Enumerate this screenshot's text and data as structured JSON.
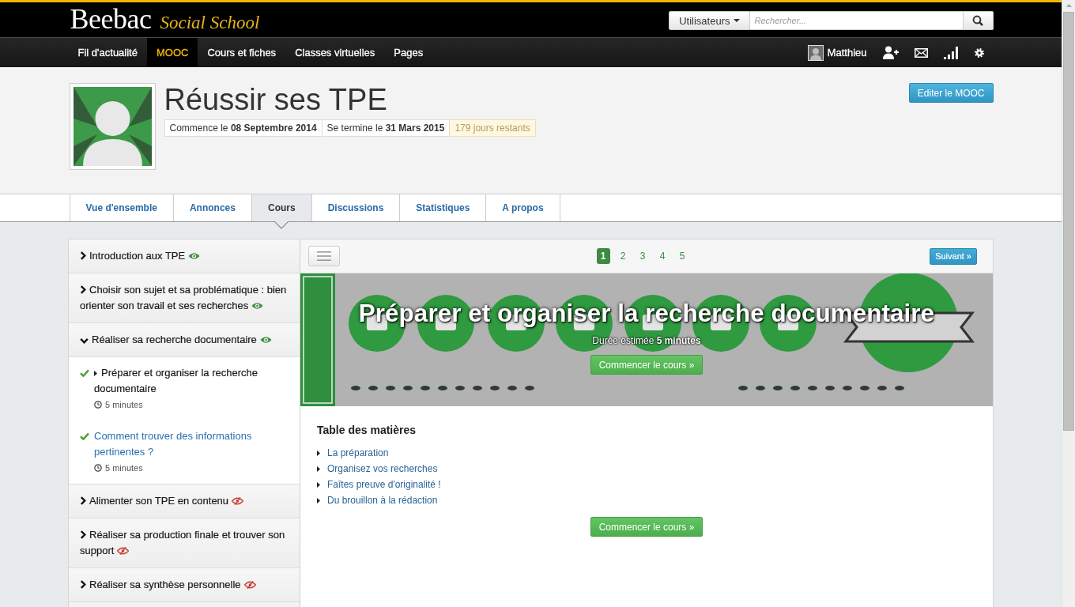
{
  "header": {
    "logo": "Beebac",
    "tagline": "Social School",
    "search": {
      "scope": "Utilisateurs",
      "placeholder": "Rechercher..."
    }
  },
  "nav": {
    "items": [
      {
        "label": "Fil d'actualité",
        "selected": false
      },
      {
        "label": "MOOC",
        "selected": true
      },
      {
        "label": "Cours et fiches",
        "selected": false
      },
      {
        "label": "Classes virtuelles",
        "selected": false
      },
      {
        "label": "Pages",
        "selected": false
      }
    ],
    "user": "Matthieu"
  },
  "course": {
    "title": "Réussir ses TPE",
    "dates": [
      {
        "kind": "date",
        "text": "Commence le **08 Septembre 2014**"
      },
      {
        "kind": "date",
        "text": "Se termine le **31 Mars 2015**"
      },
      {
        "kind": "remaining",
        "text": "179 jours restants"
      }
    ],
    "edit_button": "Editer le MOOC"
  },
  "tabs": [
    {
      "label": "Vue d'ensemble",
      "selected": false
    },
    {
      "label": "Annonces",
      "selected": false
    },
    {
      "label": "Cours",
      "selected": true
    },
    {
      "label": "Discussions",
      "selected": false
    },
    {
      "label": "Statistiques",
      "selected": false
    },
    {
      "label": "A propos",
      "selected": false
    }
  ],
  "sidebar": {
    "sections": [
      {
        "title": "Introduction aux TPE",
        "visible": true,
        "expanded": false
      },
      {
        "title": "Choisir son sujet et sa problématique : bien orienter son travail et ses recherches",
        "visible": true,
        "expanded": false
      },
      {
        "title": "Réaliser sa recherche documentaire",
        "visible": true,
        "expanded": true,
        "children": [
          {
            "title": "Préparer et organiser la recherche documentaire",
            "completed": true,
            "selected": true,
            "duration": "5 minutes"
          },
          {
            "title": "Comment trouver des informations pertinentes ?",
            "completed": true,
            "selected": false,
            "duration": "5 minutes"
          }
        ]
      },
      {
        "title": "Alimenter son TPE en contenu",
        "visible": false,
        "expanded": false
      },
      {
        "title": "Réaliser sa production finale et trouver son support",
        "visible": false,
        "expanded": false
      },
      {
        "title": "Réaliser sa synthèse personnelle",
        "visible": false,
        "expanded": false
      }
    ]
  },
  "lesson": {
    "pages": [
      {
        "label": "1",
        "selected": true
      },
      {
        "label": "2",
        "selected": false
      },
      {
        "label": "3",
        "selected": false
      },
      {
        "label": "4",
        "selected": false
      },
      {
        "label": "5",
        "selected": false
      }
    ],
    "next_button": "Suivant »",
    "banner": {
      "title": "Préparer et organiser la recherche documentaire",
      "duration": "Durée estimée **5 minutes**",
      "start_button": "Commencer le cours »"
    },
    "toc": {
      "heading": "Table des matières",
      "items": [
        "La préparation",
        "Organisez vos recherches",
        "Faîtes preuve d'originalité !",
        "Du brouillon à la rédaction"
      ]
    },
    "start_button": "Commencer le cours »"
  }
}
